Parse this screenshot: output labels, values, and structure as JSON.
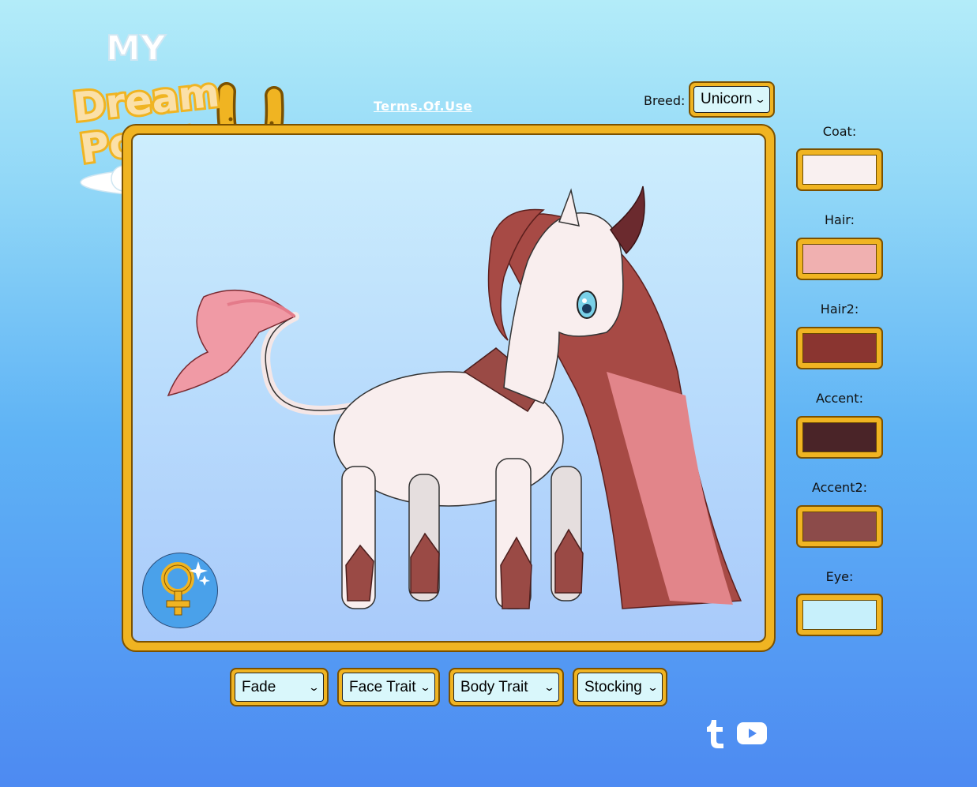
{
  "logo": {
    "line1": "MY",
    "line2": "Dream",
    "line3": "Pony"
  },
  "terms_link": "Terms.Of.Use",
  "breed": {
    "label": "Breed:",
    "value": "Unicorn"
  },
  "swatches": [
    {
      "label": "Coat:",
      "color": "#f9f0f0"
    },
    {
      "label": "Hair:",
      "color": "#f0b0b0"
    },
    {
      "label": "Hair2:",
      "color": "#8a3530"
    },
    {
      "label": "Accent:",
      "color": "#4a2428"
    },
    {
      "label": "Accent2:",
      "color": "#8c4b4a"
    },
    {
      "label": "Eye:",
      "color": "#c7f0fb"
    }
  ],
  "dropdowns": [
    {
      "value": "Fade"
    },
    {
      "value": "Face Trait"
    },
    {
      "value": "Body Trait"
    },
    {
      "value": "Stocking"
    }
  ],
  "gender_button": {
    "icon": "female-sparkle-icon"
  },
  "social": [
    {
      "icon": "tumblr-icon"
    },
    {
      "icon": "youtube-icon"
    }
  ],
  "colors": {
    "accent": "#f0b422",
    "border": "#7b5100",
    "field": "#d9f7fb"
  }
}
